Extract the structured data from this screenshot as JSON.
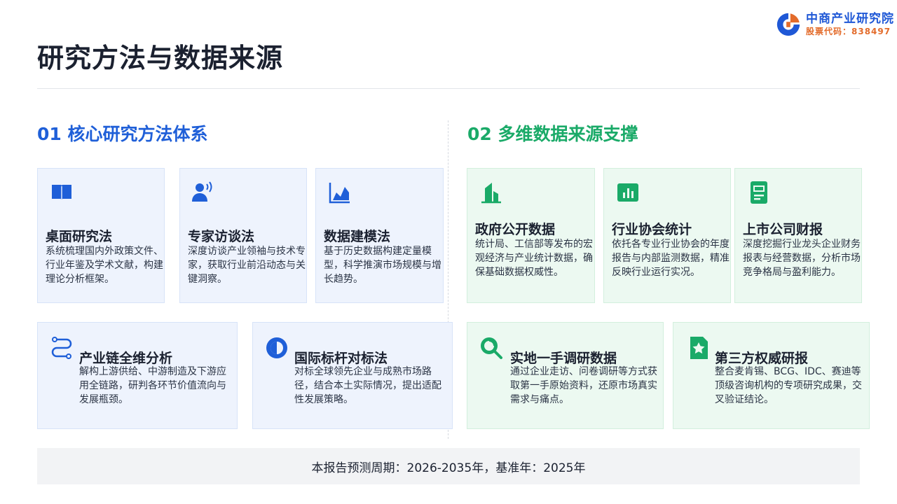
{
  "header": {
    "title": "研究方法与数据来源",
    "logo": {
      "name": "中商产业研究院",
      "stock_code": "股票代码：838497",
      "brand_blue": "#1f58d6",
      "brand_orange": "#e36b2a"
    }
  },
  "section_methods": {
    "title": "01 核心研究方法体系",
    "accent": "#1f5fd8",
    "cards": [
      {
        "icon": "book-icon",
        "title": "桌面研究法",
        "desc": "系统梳理国内外政策文件、行业年鉴及学术文献，构建理论分析框架。"
      },
      {
        "icon": "expert-speaking-icon",
        "title": "专家访谈法",
        "desc": "深度访谈产业领袖与技术专家，获取行业前沿动态与关键洞察。"
      },
      {
        "icon": "area-chart-icon",
        "title": "数据建模法",
        "desc": "基于历史数据构建定量模型，科学推演市场规模与增长趋势。"
      },
      {
        "icon": "route-icon",
        "title": "产业链全维分析",
        "desc": "解构上游供给、中游制造及下游应用全链路，研判各环节价值流向与发展瓶颈。"
      },
      {
        "icon": "contrast-icon",
        "title": "国际标杆对标法",
        "desc": "对标全球领先企业与成熟市场路径，结合本土实际情况，提出适配性发展策略。"
      }
    ]
  },
  "section_sources": {
    "title": "02 多维数据来源支撑",
    "accent": "#1aaa68",
    "cards": [
      {
        "icon": "government-building-icon",
        "title": "政府公开数据",
        "desc": "统计局、工信部等发布的宏观经济与产业统计数据，确保基础数据权威性。"
      },
      {
        "icon": "bar-chart-icon",
        "title": "行业协会统计",
        "desc": "依托各专业行业协会的年度报告与内部监测数据，精准反映行业运行实况。"
      },
      {
        "icon": "financial-report-icon",
        "title": "上市公司财报",
        "desc": "深度挖掘行业龙头企业财务报表与经营数据，分析市场竞争格局与盈利能力。"
      },
      {
        "icon": "search-icon",
        "title": "实地一手调研数据",
        "desc": "通过企业走访、问卷调研等方式获取第一手原始资料，还原市场真实需求与痛点。"
      },
      {
        "icon": "certificate-star-icon",
        "title": "第三方权威研报",
        "desc": "整合麦肯锡、BCG、IDC、赛迪等顶级咨询机构的专项研究成果，交叉验证结论。"
      }
    ]
  },
  "footer": {
    "text": "本报告预测周期：2026-2035年，基准年：2025年"
  }
}
